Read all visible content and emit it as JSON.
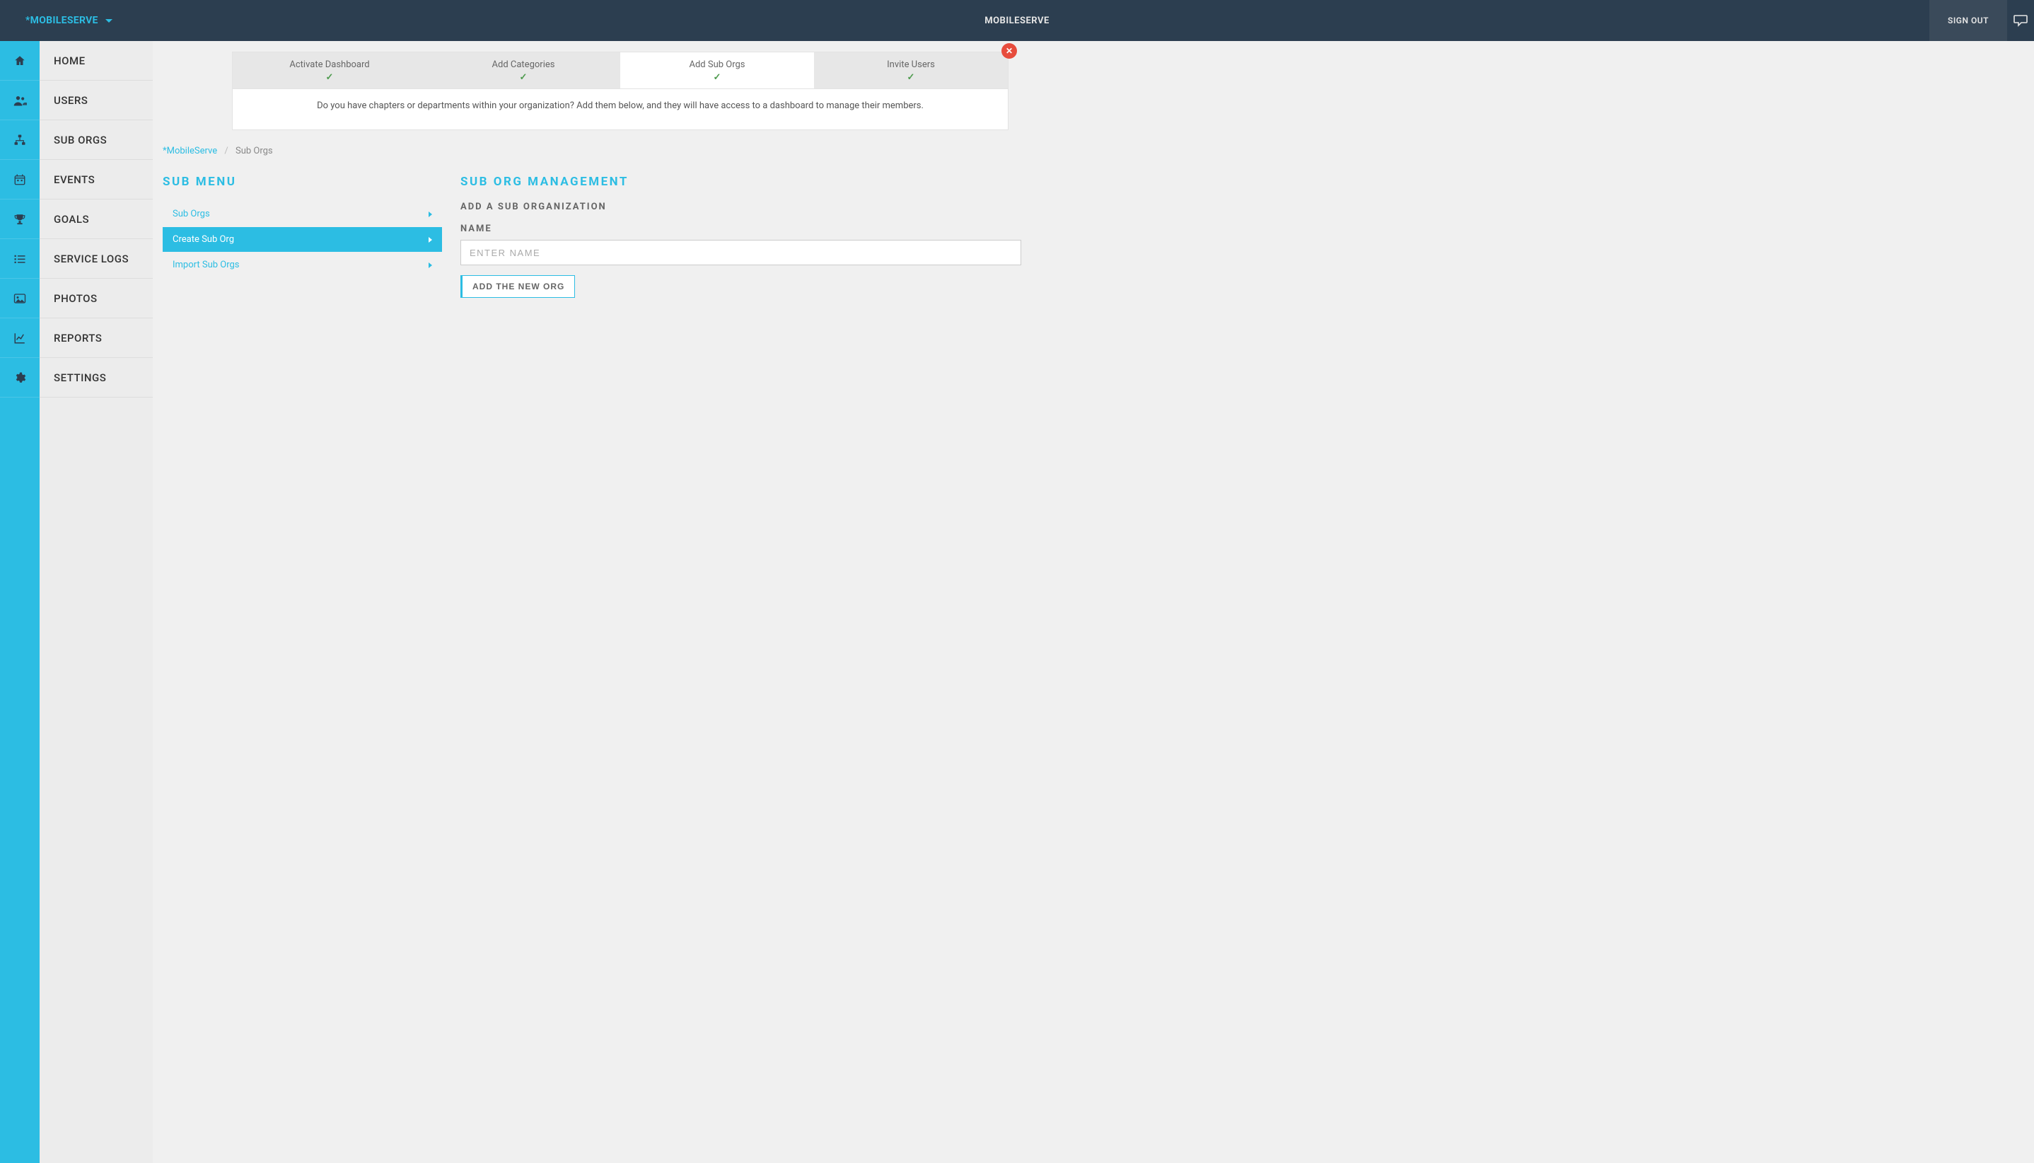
{
  "header": {
    "org_name": "*MOBILESERVE",
    "title": "MOBILESERVE",
    "signout": "SIGN OUT"
  },
  "sidebar": {
    "items": [
      {
        "label": "HOME"
      },
      {
        "label": "USERS"
      },
      {
        "label": "SUB ORGS"
      },
      {
        "label": "EVENTS"
      },
      {
        "label": "GOALS"
      },
      {
        "label": "SERVICE LOGS"
      },
      {
        "label": "PHOTOS"
      },
      {
        "label": "REPORTS"
      },
      {
        "label": "SETTINGS"
      }
    ]
  },
  "wizard": {
    "steps": [
      {
        "label": "Activate Dashboard"
      },
      {
        "label": "Add Categories"
      },
      {
        "label": "Add Sub Orgs"
      },
      {
        "label": "Invite Users"
      }
    ],
    "help": "Do you have chapters or departments within your organization? Add them below, and they will have access to a dashboard to manage their members."
  },
  "breadcrumb": {
    "root": "*MobileServe",
    "current": "Sub Orgs"
  },
  "submenu": {
    "title": "SUB MENU",
    "items": [
      {
        "label": "Sub Orgs"
      },
      {
        "label": "Create Sub Org"
      },
      {
        "label": "Import Sub Orgs"
      }
    ]
  },
  "form": {
    "section_title": "SUB ORG MANAGEMENT",
    "heading": "ADD A SUB ORGANIZATION",
    "name_label": "NAME",
    "name_placeholder": "ENTER NAME",
    "submit": "ADD THE NEW ORG"
  }
}
